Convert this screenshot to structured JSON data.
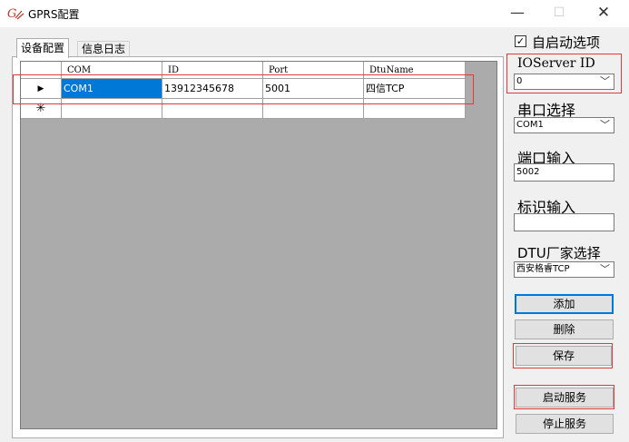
{
  "window": {
    "title": "GPRS配置",
    "icon_text": "G",
    "minimize_glyph": "—",
    "maximize_glyph": "☐",
    "close_glyph": "✕"
  },
  "tabs": [
    {
      "label": "设备配置",
      "active": true
    },
    {
      "label": "信息日志",
      "active": false
    }
  ],
  "grid": {
    "columns": [
      "COM",
      "ID",
      "Port",
      "DtuName"
    ],
    "rows": [
      {
        "indicator": "▶",
        "cells": [
          "COM1",
          "13912345678",
          "5001",
          "四信TCP"
        ]
      }
    ],
    "new_row_indicator": "✳"
  },
  "options": {
    "autostart_label": "自启动选项",
    "autostart_checked": true,
    "check_glyph": "✓"
  },
  "ioserver": {
    "label": "IOServer ID",
    "value": "0"
  },
  "serial": {
    "label": "串口选择",
    "value": "COM1"
  },
  "port": {
    "label": "端口输入",
    "value": "5002"
  },
  "ident": {
    "label": "标识输入",
    "value": ""
  },
  "vendor": {
    "label": "DTU厂家选择",
    "value": "西安格睿TCP"
  },
  "buttons": {
    "add": "添加",
    "delete": "删除",
    "save": "保存",
    "start": "启动服务",
    "stop": "停止服务"
  },
  "colors": {
    "selection": "#0078d7",
    "highlight_box": "#e03a3a"
  }
}
